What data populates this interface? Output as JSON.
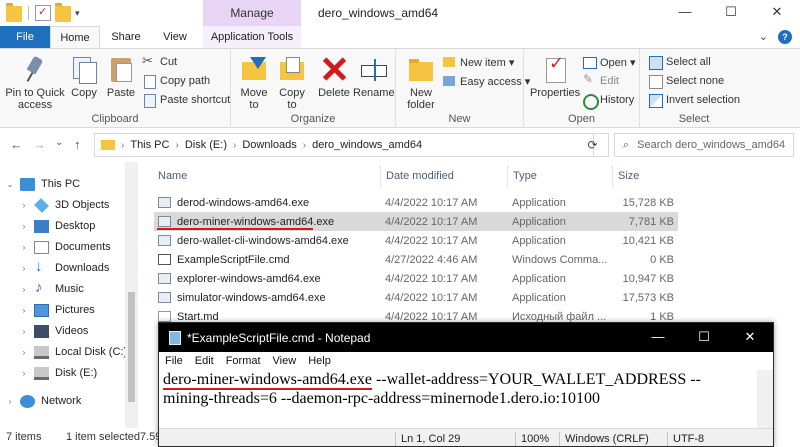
{
  "titlebar": {
    "context_tab": "Manage",
    "window_title": "dero_windows_amd64",
    "minimize": "—",
    "maximize": "☐",
    "close": "✕"
  },
  "ribbon_tabs": {
    "file": "File",
    "home": "Home",
    "share": "Share",
    "view": "View",
    "application_tools": "Application Tools",
    "collapse": "⌄",
    "help": "?"
  },
  "ribbon": {
    "clipboard": {
      "label": "Clipboard",
      "pin": "Pin to Quick access",
      "copy": "Copy",
      "paste": "Paste",
      "cut": "Cut",
      "copy_path": "Copy path",
      "paste_shortcut": "Paste shortcut"
    },
    "organize": {
      "label": "Organize",
      "move_to": "Move to",
      "copy_to": "Copy to",
      "delete": "Delete",
      "rename": "Rename"
    },
    "new": {
      "label": "New",
      "new_folder": "New folder",
      "new_item": "New item ▾",
      "easy_access": "Easy access ▾"
    },
    "open": {
      "label": "Open",
      "properties": "Properties",
      "open": "Open ▾",
      "edit": "Edit",
      "history": "History"
    },
    "select": {
      "label": "Select",
      "select_all": "Select all",
      "select_none": "Select none",
      "invert": "Invert selection"
    }
  },
  "address": {
    "back": "←",
    "forward": "→",
    "recent": "⌄",
    "up": "↑",
    "crumbs": [
      "This PC",
      "Disk (E:)",
      "Downloads",
      "dero_windows_amd64"
    ],
    "refresh": "⟳",
    "search_placeholder": "Search dero_windows_amd64"
  },
  "nav_pane": {
    "items": [
      {
        "label": "This PC",
        "icon": "computer-icon"
      },
      {
        "label": "3D Objects",
        "icon": "3d-objects-icon"
      },
      {
        "label": "Desktop",
        "icon": "desktop-icon"
      },
      {
        "label": "Documents",
        "icon": "documents-icon"
      },
      {
        "label": "Downloads",
        "icon": "downloads-icon"
      },
      {
        "label": "Music",
        "icon": "music-icon"
      },
      {
        "label": "Pictures",
        "icon": "pictures-icon"
      },
      {
        "label": "Videos",
        "icon": "videos-icon"
      },
      {
        "label": "Local Disk (C:)",
        "icon": "drive-icon"
      },
      {
        "label": "Disk (E:)",
        "icon": "drive-icon"
      },
      {
        "label": "Network",
        "icon": "network-icon"
      }
    ]
  },
  "file_list": {
    "columns": {
      "name": "Name",
      "date": "Date modified",
      "type": "Type",
      "size": "Size"
    },
    "rows": [
      {
        "name": "derod-windows-amd64.exe",
        "date": "4/4/2022 10:17 AM",
        "type": "Application",
        "size": "15,728 KB",
        "icon": "exe-icon"
      },
      {
        "name": "dero-miner-windows-amd64.exe",
        "date": "4/4/2022 10:17 AM",
        "type": "Application",
        "size": "7,781 KB",
        "icon": "exe-icon",
        "selected": true
      },
      {
        "name": "dero-wallet-cli-windows-amd64.exe",
        "date": "4/4/2022 10:17 AM",
        "type": "Application",
        "size": "10,421 KB",
        "icon": "exe-icon"
      },
      {
        "name": "ExampleScriptFile.cmd",
        "date": "4/27/2022 4:46 AM",
        "type": "Windows Comma...",
        "size": "0 KB",
        "icon": "cmd-icon"
      },
      {
        "name": "explorer-windows-amd64.exe",
        "date": "4/4/2022 10:17 AM",
        "type": "Application",
        "size": "10,947 KB",
        "icon": "exe-icon"
      },
      {
        "name": "simulator-windows-amd64.exe",
        "date": "4/4/2022 10:17 AM",
        "type": "Application",
        "size": "17,573 KB",
        "icon": "exe-icon"
      },
      {
        "name": "Start.md",
        "date": "4/4/2022 10:17 AM",
        "type": "Исходный файл ...",
        "size": "1 KB",
        "icon": "md-icon"
      }
    ]
  },
  "status": {
    "items": "7 items",
    "selected": "1 item selected",
    "selected_size": "7.59"
  },
  "notepad": {
    "title": "*ExampleScriptFile.cmd - Notepad",
    "menu": [
      "File",
      "Edit",
      "Format",
      "View",
      "Help"
    ],
    "text_highlight": "dero-miner-windows-amd64.exe",
    "text_rest_line1": " --wallet-address=YOUR_WALLET_ADDRESS --",
    "text_line2": "mining-threads=6 --daemon-rpc-address=minernode1.dero.io:10100",
    "status": {
      "position": "Ln 1, Col 29",
      "zoom": "100%",
      "line_endings": "Windows (CRLF)",
      "encoding": "UTF-8"
    },
    "minimize": "—",
    "maximize": "☐",
    "close": "✕"
  }
}
